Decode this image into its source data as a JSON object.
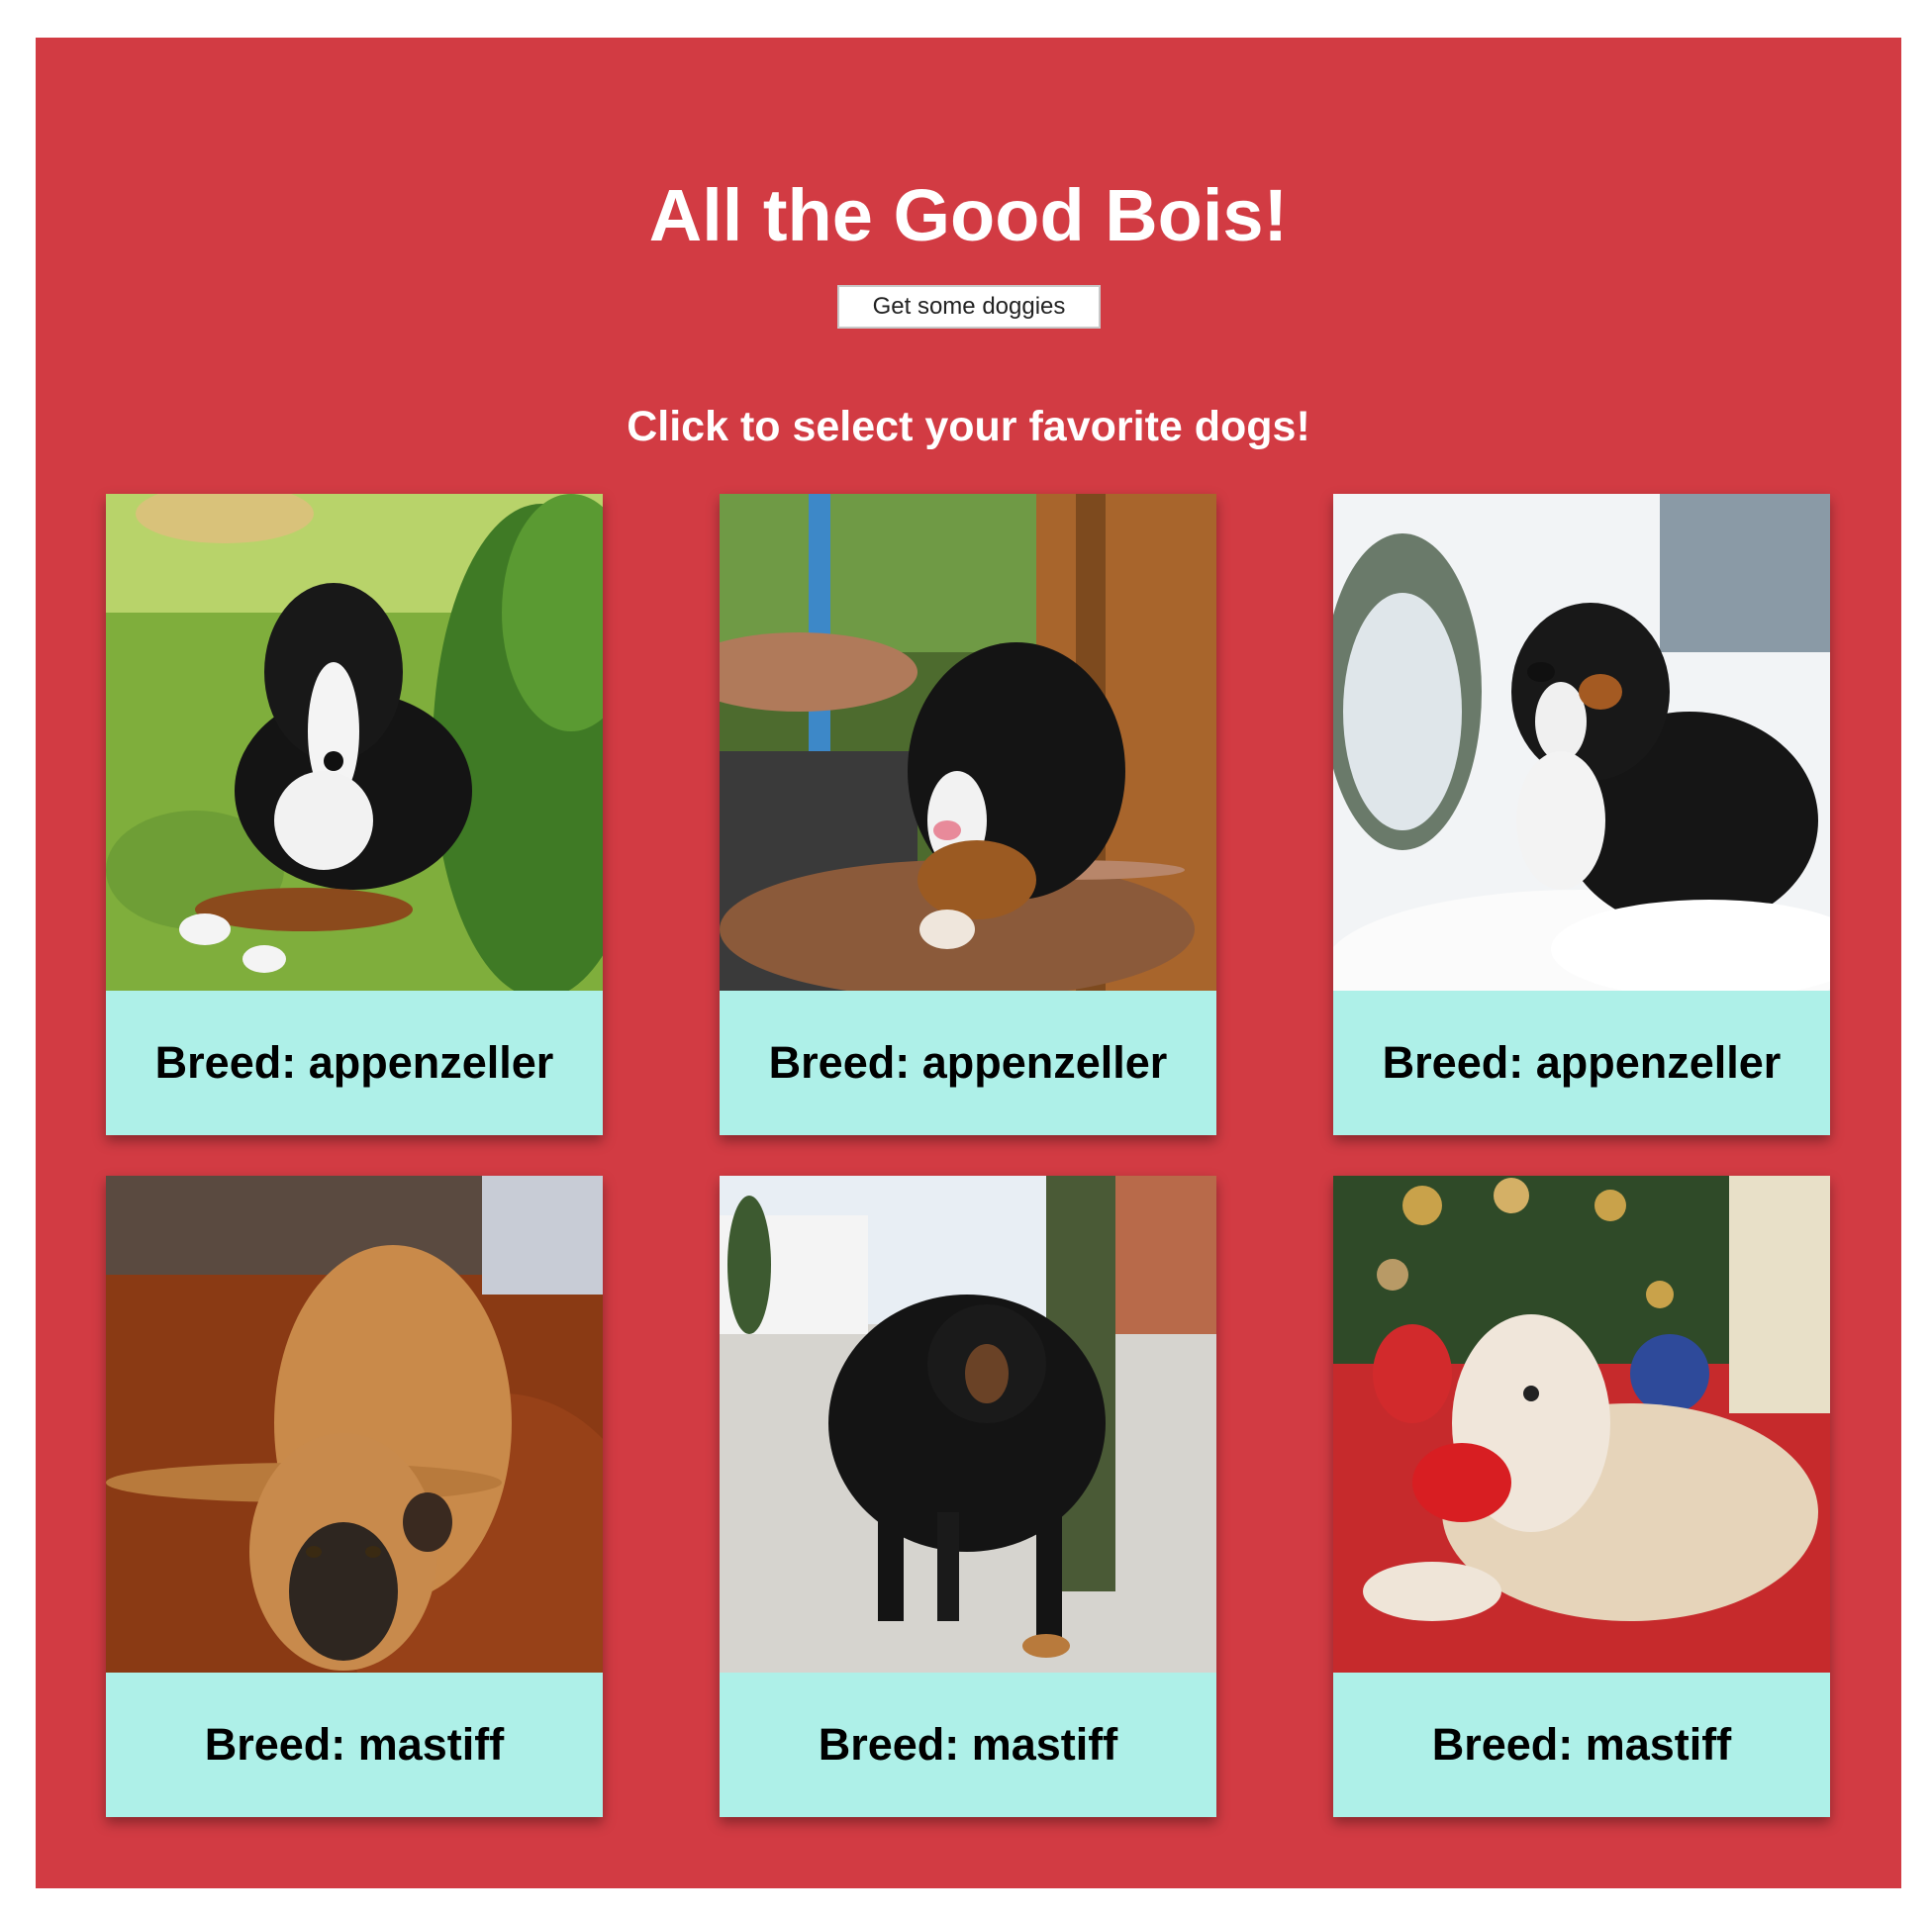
{
  "header": {
    "title": "All the Good Bois!",
    "fetch_button_label": "Get some doggies",
    "subtitle": "Click to select your favorite dogs!"
  },
  "colors": {
    "panel_background": "#d23b43",
    "caption_background": "#aef0e8",
    "heading_text": "#ffffff"
  },
  "dogs": [
    {
      "breed_label": "Breed: appenzeller",
      "scene": "puppy lying on grass beside a bush"
    },
    {
      "breed_label": "Breed: appenzeller",
      "scene": "puppy held on a lap near a wooden post"
    },
    {
      "breed_label": "Breed: appenzeller",
      "scene": "dog sitting in deep snow"
    },
    {
      "breed_label": "Breed: mastiff",
      "scene": "fawn mastiff lying on a wooden floor"
    },
    {
      "breed_label": "Breed: mastiff",
      "scene": "black and tan mastiff standing on paved street"
    },
    {
      "breed_label": "Breed: mastiff",
      "scene": "shaggy cream dog lying on red rug under christmas tree"
    }
  ]
}
